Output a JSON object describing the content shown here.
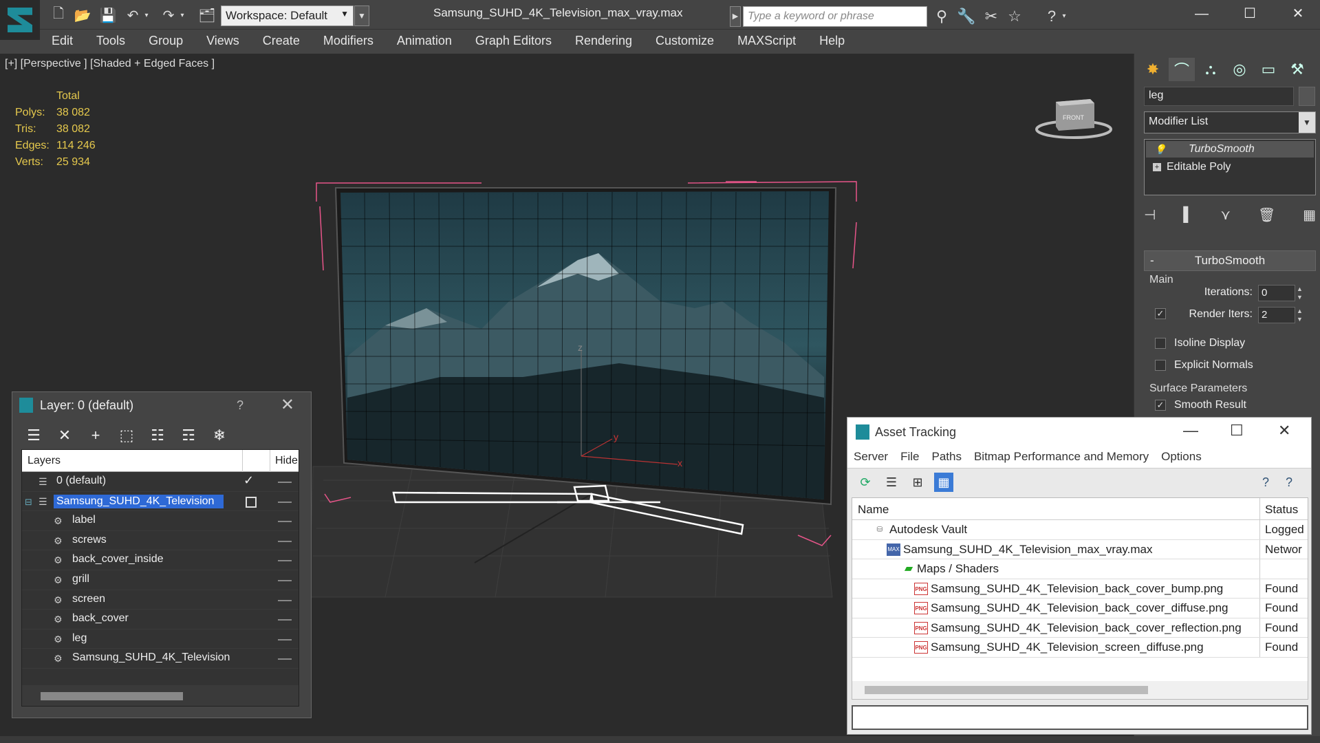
{
  "app": {
    "document_title": "Samsung_SUHD_4K_Television_max_vray.max",
    "workspace_label": "Workspace: Default",
    "search_placeholder": "Type a keyword or phrase"
  },
  "menu": [
    "Edit",
    "Tools",
    "Group",
    "Views",
    "Create",
    "Modifiers",
    "Animation",
    "Graph Editors",
    "Rendering",
    "Customize",
    "MAXScript",
    "Help"
  ],
  "viewport": {
    "label": "[+] [Perspective ] [Shaded + Edged Faces ]",
    "stats": {
      "header": "Total",
      "rows": [
        {
          "k": "Polys:",
          "v": "38 082"
        },
        {
          "k": "Tris:",
          "v": "38 082"
        },
        {
          "k": "Edges:",
          "v": "114 246"
        },
        {
          "k": "Verts:",
          "v": "25 934"
        }
      ]
    },
    "gizmo_labels": {
      "z": "z",
      "y": "y",
      "x": "x"
    },
    "viewcube_label": "FRONT"
  },
  "command_panel": {
    "object_name": "leg",
    "modifier_list": "Modifier List",
    "stack": [
      {
        "label": "TurboSmooth",
        "selected": true
      },
      {
        "label": "Editable Poly",
        "selected": false
      }
    ],
    "rollout_title": "TurboSmooth",
    "group_main": "Main",
    "iterations_label": "Iterations:",
    "iterations_value": "0",
    "render_iters_label": "Render Iters:",
    "render_iters_value": "2",
    "isoline_label": "Isoline Display",
    "explicit_normals_label": "Explicit Normals",
    "surface_params_label": "Surface Parameters",
    "smooth_result_label": "Smooth Result"
  },
  "layer_dialog": {
    "title": "Layer: 0 (default)",
    "help": "?",
    "col_layers": "Layers",
    "col_hide": "Hide",
    "rows": [
      {
        "name": "0 (default)",
        "indent": 1,
        "type": "layer"
      },
      {
        "name": "Samsung_SUHD_4K_Television",
        "indent": 1,
        "type": "layer",
        "selected": true
      },
      {
        "name": "label",
        "indent": 2,
        "type": "object"
      },
      {
        "name": "screws",
        "indent": 2,
        "type": "object"
      },
      {
        "name": "back_cover_inside",
        "indent": 2,
        "type": "object"
      },
      {
        "name": "grill",
        "indent": 2,
        "type": "object"
      },
      {
        "name": "screen",
        "indent": 2,
        "type": "object"
      },
      {
        "name": "back_cover",
        "indent": 2,
        "type": "object"
      },
      {
        "name": "leg",
        "indent": 2,
        "type": "object"
      },
      {
        "name": "Samsung_SUHD_4K_Television",
        "indent": 2,
        "type": "object"
      }
    ]
  },
  "asset_dialog": {
    "title": "Asset Tracking",
    "menu": [
      "Server",
      "File",
      "Paths",
      "Bitmap Performance and Memory",
      "Options"
    ],
    "col_name": "Name",
    "col_status": "Status",
    "rows": [
      {
        "name": "Autodesk Vault",
        "status": "Logged",
        "indent": 0,
        "icon": "vault"
      },
      {
        "name": "Samsung_SUHD_4K_Television_max_vray.max",
        "status": "Networ",
        "indent": 1,
        "icon": "max"
      },
      {
        "name": "Maps / Shaders",
        "status": "",
        "indent": 2,
        "icon": "maps"
      },
      {
        "name": "Samsung_SUHD_4K_Television_back_cover_bump.png",
        "status": "Found",
        "indent": 3,
        "icon": "png"
      },
      {
        "name": "Samsung_SUHD_4K_Television_back_cover_diffuse.png",
        "status": "Found",
        "indent": 3,
        "icon": "png"
      },
      {
        "name": "Samsung_SUHD_4K_Television_back_cover_reflection.png",
        "status": "Found",
        "indent": 3,
        "icon": "png"
      },
      {
        "name": "Samsung_SUHD_4K_Television_screen_diffuse.png",
        "status": "Found",
        "indent": 3,
        "icon": "png"
      }
    ]
  },
  "colors": {
    "selection_blue": "#2e69d6",
    "stats_yellow": "#e6c94d",
    "bbox_pink": "#e8558a",
    "accent_teal": "#1e8c9a"
  }
}
